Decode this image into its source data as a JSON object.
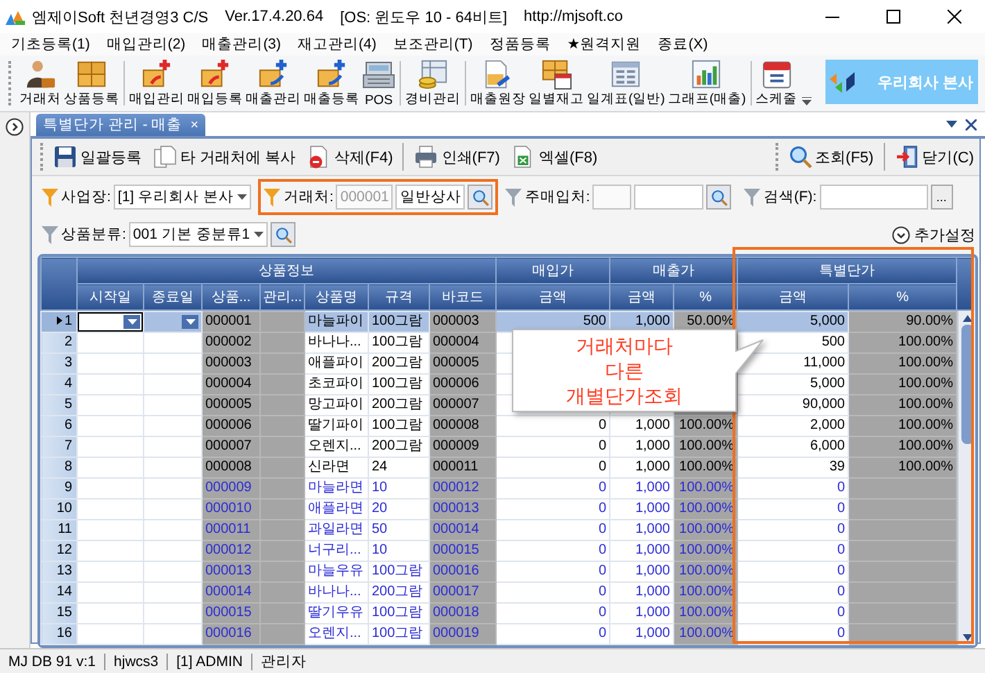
{
  "window": {
    "title": "엠제이Soft 천년경영3 C/S",
    "version": "Ver.17.4.20.64",
    "os": "[OS: 윈도우 10 - 64비트]",
    "url": "http://mjsoft.co"
  },
  "menu": [
    "기초등록(1)",
    "매입관리(2)",
    "매출관리(3)",
    "재고관리(4)",
    "보조관리(T)",
    "정품등록",
    "★원격지원",
    "종료(X)"
  ],
  "toolbar_groups": [
    [
      {
        "label": "거래처",
        "kind": "person"
      },
      {
        "label": "상품등록",
        "kind": "boxes"
      }
    ],
    [
      {
        "label": "매입관리",
        "kind": "box-in"
      },
      {
        "label": "매입등록",
        "kind": "box-in"
      },
      {
        "label": "매출관리",
        "kind": "box-out"
      },
      {
        "label": "매출등록",
        "kind": "box-out"
      },
      {
        "label": "POS",
        "kind": "register"
      }
    ],
    [
      {
        "label": "경비관리",
        "kind": "coins"
      }
    ],
    [
      {
        "label": "매출원장",
        "kind": "ledger"
      },
      {
        "label": "일별재고",
        "kind": "stock"
      },
      {
        "label": "일계표(일반)",
        "kind": "table"
      },
      {
        "label": "그래프(매출)",
        "kind": "chart"
      }
    ],
    [
      {
        "label": "스케줄",
        "kind": "calendar"
      }
    ]
  ],
  "company_banner": "우리회사 본사",
  "doc_tab": {
    "title": "특별단가 관리 - 매출",
    "close": "×",
    "selected": true
  },
  "actions_left": [
    {
      "label": "일괄등록",
      "kind": "save"
    },
    {
      "label": "타 거래처에 복사",
      "kind": "copy"
    },
    {
      "label": "삭제(F4)",
      "kind": "delete"
    },
    {
      "label": "인쇄(F7)",
      "kind": "print"
    },
    {
      "label": "엑셀(F8)",
      "kind": "excel"
    }
  ],
  "actions_right": [
    {
      "label": "조회(F5)",
      "kind": "search"
    },
    {
      "label": "닫기(C)",
      "kind": "exit"
    }
  ],
  "filter_rows": [
    [
      {
        "kind": "select",
        "label": "사업장:",
        "value": "[1] 우리회사 본사",
        "active": true,
        "highlighted": false
      },
      {
        "kind": "lookup",
        "label": "거래처:",
        "code": "000001",
        "value": "일반상사",
        "active": true,
        "highlighted": true
      },
      {
        "kind": "lookup",
        "label": "주매입처:",
        "active": false,
        "highlighted": false
      },
      {
        "kind": "text",
        "label": "검색(F):",
        "button": "...",
        "active": false,
        "highlighted": false
      }
    ],
    [
      {
        "kind": "select-lookup",
        "label": "상품분류:",
        "value": "001 기본 중분류1",
        "active": false,
        "highlighted": false
      }
    ]
  ],
  "more_settings": "추가설정",
  "grid": {
    "groups": [
      {
        "label": "상품정보",
        "columns": [
          "시작일",
          "종료일",
          "상품...",
          "관리...",
          "상품명",
          "규격",
          "바코드"
        ],
        "framed": false
      },
      {
        "label": "매입가",
        "columns": [
          "금액"
        ],
        "framed": false
      },
      {
        "label": "매출가",
        "columns": [
          "금액",
          "%"
        ],
        "framed": false
      },
      {
        "label": "특별단가",
        "columns": [
          "금액",
          "%"
        ],
        "framed": true
      }
    ],
    "rows": [
      {
        "number": "1",
        "selected": true,
        "color": "#000000",
        "code": "000001",
        "name": "마늘파이",
        "spec": "100그람",
        "barcode": "000003",
        "purchase": "500",
        "sale": "1,000",
        "sale_pct": "50.00%",
        "special": "5,000",
        "special_pct": "90.00%"
      },
      {
        "number": "2",
        "selected": false,
        "color": "#000000",
        "code": "000002",
        "name": "바나나...",
        "spec": "100그람",
        "barcode": "000004",
        "special": "500",
        "special_pct": "100.00%"
      },
      {
        "number": "3",
        "selected": false,
        "color": "#000000",
        "code": "000003",
        "name": "애플파이",
        "spec": "200그람",
        "barcode": "000005",
        "special": "11,000",
        "special_pct": "100.00%"
      },
      {
        "number": "4",
        "selected": false,
        "color": "#000000",
        "code": "000004",
        "name": "초코파이",
        "spec": "100그람",
        "barcode": "000006",
        "special": "5,000",
        "special_pct": "100.00%"
      },
      {
        "number": "5",
        "selected": false,
        "color": "#000000",
        "code": "000005",
        "name": "망고파이",
        "spec": "200그람",
        "barcode": "000007",
        "special": "90,000",
        "special_pct": "100.00%"
      },
      {
        "number": "6",
        "selected": false,
        "color": "#000000",
        "code": "000006",
        "name": "딸기파이",
        "spec": "100그람",
        "barcode": "000008",
        "purchase": "0",
        "sale": "1,000",
        "sale_pct": "100.00%",
        "special": "2,000",
        "special_pct": "100.00%"
      },
      {
        "number": "7",
        "selected": false,
        "color": "#000000",
        "code": "000007",
        "name": "오렌지...",
        "spec": "200그람",
        "barcode": "000009",
        "purchase": "0",
        "sale": "1,000",
        "sale_pct": "100.00%",
        "special": "6,000",
        "special_pct": "100.00%"
      },
      {
        "number": "8",
        "selected": false,
        "color": "#000000",
        "code": "000008",
        "name": "신라면",
        "spec": "24",
        "barcode": "000011",
        "purchase": "0",
        "sale": "1,000",
        "sale_pct": "100.00%",
        "special": "39",
        "special_pct": "100.00%"
      },
      {
        "number": "9",
        "selected": false,
        "color": "#2b2bd6",
        "code": "000009",
        "name": "마늘라면",
        "spec": "10",
        "barcode": "000012",
        "purchase": "0",
        "sale": "1,000",
        "sale_pct": "100.00%",
        "special": "0"
      },
      {
        "number": "10",
        "selected": false,
        "color": "#2b2bd6",
        "code": "000010",
        "name": "애플라면",
        "spec": "20",
        "barcode": "000013",
        "purchase": "0",
        "sale": "1,000",
        "sale_pct": "100.00%",
        "special": "0"
      },
      {
        "number": "11",
        "selected": false,
        "color": "#2b2bd6",
        "code": "000011",
        "name": "과일라면",
        "spec": "50",
        "barcode": "000014",
        "purchase": "0",
        "sale": "1,000",
        "sale_pct": "100.00%",
        "special": "0"
      },
      {
        "number": "12",
        "selected": false,
        "color": "#2b2bd6",
        "code": "000012",
        "name": "너구리...",
        "spec": "10",
        "barcode": "000015",
        "purchase": "0",
        "sale": "1,000",
        "sale_pct": "100.00%",
        "special": "0"
      },
      {
        "number": "13",
        "selected": false,
        "color": "#2b2bd6",
        "code": "000013",
        "name": "마늘우유",
        "spec": "100그람",
        "barcode": "000016",
        "purchase": "0",
        "sale": "1,000",
        "sale_pct": "100.00%",
        "special": "0"
      },
      {
        "number": "14",
        "selected": false,
        "color": "#2b2bd6",
        "code": "000014",
        "name": "바나나...",
        "spec": "200그람",
        "barcode": "000017",
        "purchase": "0",
        "sale": "1,000",
        "sale_pct": "100.00%",
        "special": "0"
      },
      {
        "number": "15",
        "selected": false,
        "color": "#2b2bd6",
        "code": "000015",
        "name": "딸기우유",
        "spec": "100그람",
        "barcode": "000018",
        "purchase": "0",
        "sale": "1,000",
        "sale_pct": "100.00%",
        "special": "0"
      },
      {
        "number": "16",
        "selected": false,
        "color": "#2b2bd6",
        "code": "000016",
        "name": "오렌지...",
        "spec": "100그람",
        "barcode": "000019",
        "purchase": "0",
        "sale": "1,000",
        "sale_pct": "100.00%",
        "special": "0"
      }
    ],
    "callout": "거래처마다\n다른\n개별단가조회"
  },
  "status_bar": [
    "MJ DB 91 v:1",
    "hjwcs3",
    "[1] ADMIN",
    "관리자"
  ]
}
